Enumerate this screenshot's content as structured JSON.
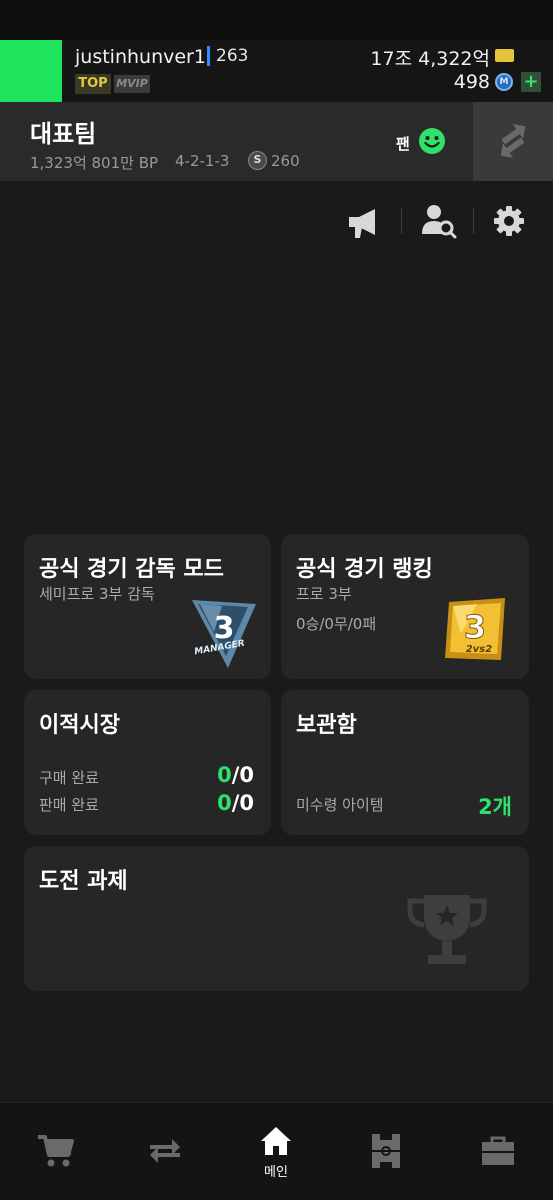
{
  "profile": {
    "username": "justinhunver1",
    "level": "263",
    "tag_top": "TOP",
    "tag_vip": "MVIP",
    "money": "17조 4,322억",
    "points": "498",
    "coin_glyph": "M",
    "plus": "+",
    "accent_color": "#1ee35c"
  },
  "team": {
    "title": "대표팀",
    "bp": "1,323억 801만 BP",
    "formation": "4-2-1-3",
    "salary_icon": "S",
    "salary": "260",
    "fan_label": "팬"
  },
  "top_icons": [
    "megaphone-icon",
    "user-search-icon",
    "gear-icon"
  ],
  "cards": {
    "manager_mode": {
      "title": "공식 경기 감독 모드",
      "subtitle": "세미프로 3부 감독",
      "badge_number": "3",
      "badge_text": "MANAGER"
    },
    "ranking": {
      "title": "공식 경기 랭킹",
      "subtitle": "프로 3부",
      "record": "0승/0무/0패",
      "badge_number": "3",
      "badge_text": "2vs2"
    },
    "transfer": {
      "title": "이적시장",
      "buy_label": "구매 완료",
      "buy_done": "0",
      "buy_total": "/0",
      "sell_label": "판매 완료",
      "sell_done": "0",
      "sell_total": "/0"
    },
    "storage": {
      "title": "보관함",
      "unclaimed_label": "미수령 아이템",
      "unclaimed_count": "2개"
    },
    "challenge": {
      "title": "도전 과제"
    }
  },
  "nav": [
    {
      "icon": "cart-icon",
      "label": ""
    },
    {
      "icon": "transfer-arrows-icon",
      "label": ""
    },
    {
      "icon": "home-icon",
      "label": "메인"
    },
    {
      "icon": "field-icon",
      "label": ""
    },
    {
      "icon": "briefcase-icon",
      "label": ""
    }
  ]
}
